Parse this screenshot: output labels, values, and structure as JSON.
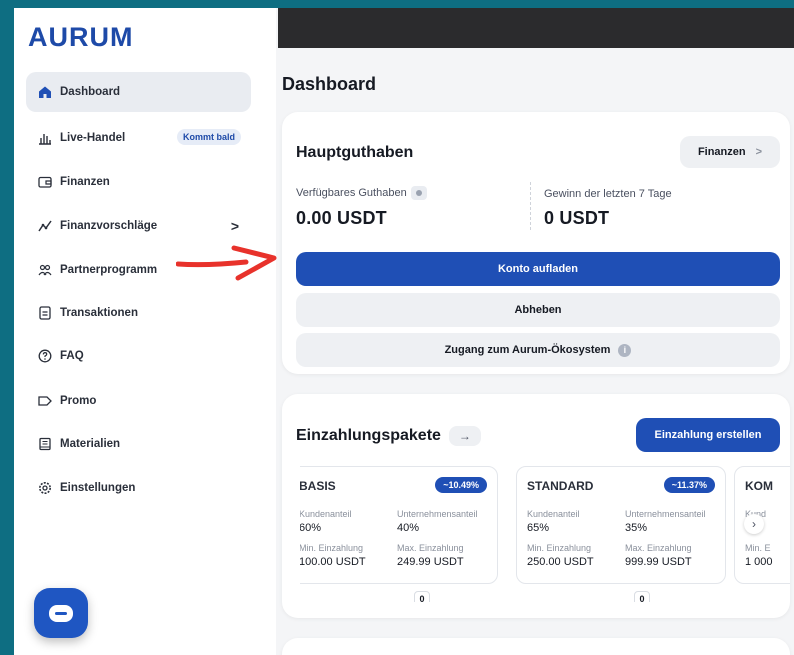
{
  "brand": {
    "logo": "AURUM",
    "accent": "#1f4fb5",
    "frame_bg": "#0e6e82"
  },
  "sidebar": {
    "items": [
      {
        "label": "Dashboard",
        "icon": "home-icon",
        "active": true
      },
      {
        "label": "Live-Handel",
        "icon": "chart-bars-icon",
        "badge": "Kommt bald"
      },
      {
        "label": "Finanzen",
        "icon": "wallet-icon"
      },
      {
        "label": "Finanzvorschläge",
        "icon": "trend-line-icon",
        "chevron": ">"
      },
      {
        "label": "Partnerprogramm",
        "icon": "users-icon"
      },
      {
        "label": "Transaktionen",
        "icon": "document-icon"
      },
      {
        "label": "FAQ",
        "icon": "help-icon"
      },
      {
        "label": "Promo",
        "icon": "tag-icon"
      },
      {
        "label": "Materialien",
        "icon": "book-icon"
      },
      {
        "label": "Einstellungen",
        "icon": "gear-icon"
      }
    ]
  },
  "page": {
    "title": "Dashboard"
  },
  "balance": {
    "title": "Hauptguthaben",
    "finance_button": "Finanzen",
    "finance_chevron": ">",
    "available_label": "Verfügbares Guthaben",
    "available_value": "0.00 USDT",
    "profit_label": "Gewinn der letzten 7 Tage",
    "profit_value": "0 USDT",
    "topup_button": "Konto aufladen",
    "withdraw_button": "Abheben",
    "ecosystem_button": "Zugang zum Aurum-Ökosystem"
  },
  "packages": {
    "title": "Einzahlungspakete",
    "title_arrow": "→",
    "create_button": "Einzahlung erstellen",
    "items": [
      {
        "name": "BASIS",
        "rate": "~10.49%",
        "client_share_label": "Kundenanteil",
        "client_share": "60%",
        "company_share_label": "Unternehmensanteil",
        "company_share": "40%",
        "min_label": "Min. Einzahlung",
        "min": "100.00 USDT",
        "max_label": "Max. Einzahlung",
        "max": "249.99 USDT",
        "count": "0"
      },
      {
        "name": "STANDARD",
        "rate": "~11.37%",
        "client_share_label": "Kundenanteil",
        "client_share": "65%",
        "company_share_label": "Unternehmensanteil",
        "company_share": "35%",
        "min_label": "Min. Einzahlung",
        "min": "250.00 USDT",
        "max_label": "Max. Einzahlung",
        "max": "999.99 USDT",
        "count": "0"
      },
      {
        "name": "KOM",
        "client_share_label": "Kund",
        "min_label": "Min. E",
        "min": "1 000"
      }
    ]
  }
}
